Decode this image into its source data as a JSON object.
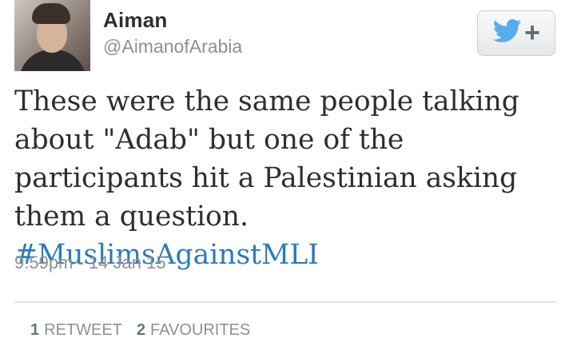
{
  "user": {
    "name": "Aiman",
    "handle": "@AimanofArabia"
  },
  "follow_button": {
    "icon": "twitter-bird-icon",
    "plus": "+"
  },
  "tweet": {
    "text": "These were the same people talking about \"Adab\" but one of the participants hit a Palestinian asking them a question.",
    "hashtag": "#MuslimsAgainstMLI",
    "timestamp": "9:59pm - 14 Jan 15"
  },
  "stats": {
    "retweets_count": "1",
    "retweets_label": "RETWEET",
    "favourites_count": "2",
    "favourites_label": "FAVOURITES"
  },
  "colors": {
    "link": "#2b7bb9",
    "twitter_blue": "#55acee",
    "text": "#292f33",
    "muted": "#8b9196"
  }
}
